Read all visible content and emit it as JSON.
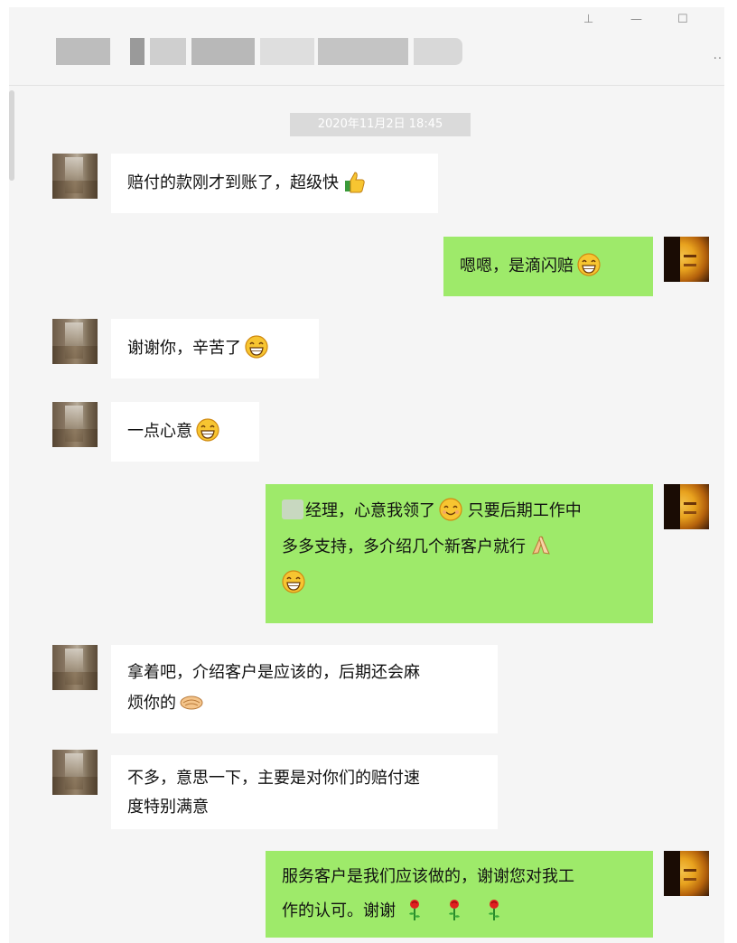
{
  "window": {
    "pin_icon": "pin-icon",
    "minimize_icon": "minimize-icon",
    "maximize_icon": "maximize-icon",
    "more_icon": "more-icon",
    "pin_glyph": "⊥",
    "minimize_glyph": "—",
    "maximize_glyph": "☐",
    "more_glyph": "··"
  },
  "chat": {
    "timestamp": "2020年11月2日 18:45",
    "messages": [
      {
        "side": "left",
        "text": "赔付的款刚才到账了，超级快",
        "emoji": "thumbs-up-icon"
      },
      {
        "side": "right",
        "text": "嗯嗯，是滴闪赔",
        "emoji": "grin-icon"
      },
      {
        "side": "left",
        "text": "谢谢你，辛苦了",
        "emoji": "grin-icon"
      },
      {
        "side": "left",
        "text": "一点心意",
        "emoji": "grin-icon"
      },
      {
        "side": "right",
        "line1": "经理，心意我领了",
        "line1b": "只要后期工作中",
        "line2": "多多支持，多介绍几个新客户就行"
      },
      {
        "side": "left",
        "line1": "拿着吧，介绍客户是应该的，后期还会麻",
        "line2": "烦你的"
      },
      {
        "side": "left",
        "line1": "不多，意思一下，主要是对你们的赔付速",
        "line2": "度特别满意"
      },
      {
        "side": "right",
        "line1": "服务客户是我们应该做的，谢谢您对我工",
        "line2": "作的认可。谢谢"
      }
    ]
  },
  "colors": {
    "window_bg": "#f5f5f5",
    "bubble_self": "#9eea6a",
    "bubble_other": "#ffffff",
    "timestamp_bg": "#dadada"
  }
}
